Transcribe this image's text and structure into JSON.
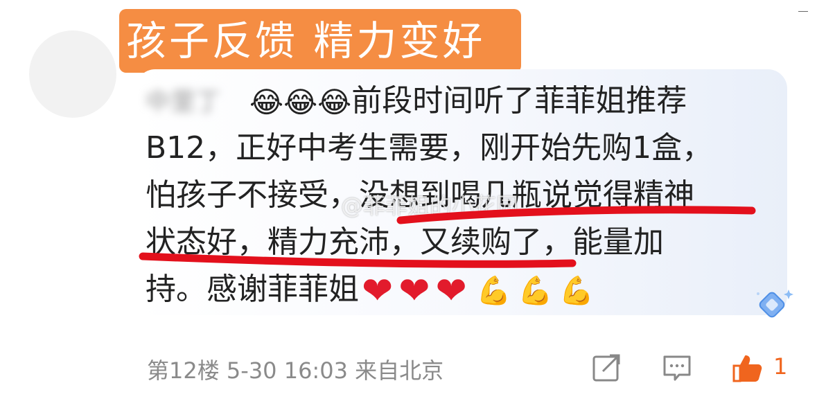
{
  "post": {
    "title_banner": "孩子反馈 精力变好",
    "author_blurred": "中里丁",
    "lines": [
      "前段时间听了菲菲姐推荐",
      "B12，正好中考生需要，刚开始先购1盒，",
      "怕孩子不接受，没想到喝几瓶说觉得精神",
      "状态好，精力充沛，又续购了，能量加",
      "持。感谢菲菲姐"
    ],
    "watermark": "@菲菲姐的小花园",
    "emojis": {
      "laugh": "😂",
      "heart": "❤",
      "arm": "💪"
    }
  },
  "footer": {
    "floor": "第12楼",
    "datetime": "5-30 16:03",
    "location": "来自北京",
    "like_count": "1"
  },
  "colors": {
    "banner": "#f58d43",
    "underline": "#e3101c",
    "like": "#f0651e",
    "meta": "#8a8a8a"
  },
  "icons": {
    "share": "share-icon",
    "comment": "comment-icon",
    "like": "thumbs-up-icon",
    "sparkle": "diamond-sparkle-icon"
  }
}
